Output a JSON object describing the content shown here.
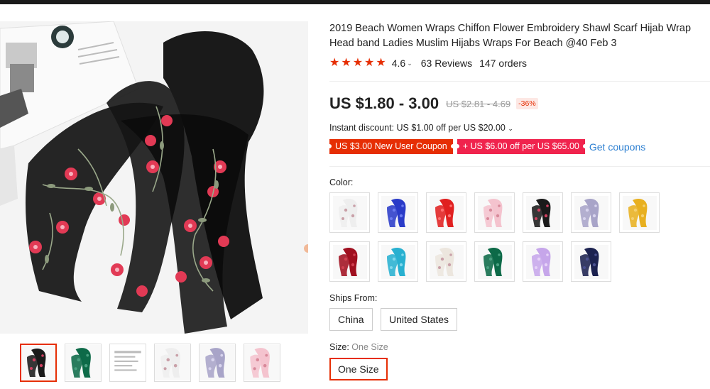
{
  "product": {
    "title": "2019 Beach Women Wraps Chiffon Flower Embroidery Shawl Scarf Hijab Wrap Head band Ladies Muslim Hijabs Wraps For Beach @40 Feb 3",
    "rating": "4.6",
    "reviews": "63 Reviews",
    "orders": "147 orders",
    "price": "US $1.80 - 3.00",
    "original_price": "US $2.81 - 4.69",
    "discount": "-36%",
    "instant_discount": "Instant discount: US $1.00 off per US $20.00",
    "coupons": [
      "US $3.00 New User Coupon",
      "+ US $6.00 off per US $65.00"
    ],
    "get_coupons": "Get coupons"
  },
  "colors": {
    "brand": "#e62e04",
    "link": "#2c7fd1"
  },
  "options": {
    "color_label": "Color:",
    "color_swatches": [
      {
        "name": "white",
        "color": "#eeeeee",
        "accent": "#c9a0a8"
      },
      {
        "name": "royal-blue",
        "color": "#2a3bc8",
        "accent": "#6b7bf0"
      },
      {
        "name": "red",
        "color": "#e02020",
        "accent": "#ff7070"
      },
      {
        "name": "light-pink",
        "color": "#f4c3ce",
        "accent": "#d8899a"
      },
      {
        "name": "black",
        "color": "#1a1a1a",
        "accent": "#d04060"
      },
      {
        "name": "lavender-grey",
        "color": "#a8a4c8",
        "accent": "#d8d4ee"
      },
      {
        "name": "mustard",
        "color": "#e8b020",
        "accent": "#f5d070"
      },
      {
        "name": "burgundy",
        "color": "#a01020",
        "accent": "#d04050"
      },
      {
        "name": "turquoise",
        "color": "#28b0d0",
        "accent": "#80d8ec"
      },
      {
        "name": "ivory",
        "color": "#ece6de",
        "accent": "#c9a0a8"
      },
      {
        "name": "dark-green",
        "color": "#0d6a48",
        "accent": "#4aa080"
      },
      {
        "name": "lilac",
        "color": "#c6a6ea",
        "accent": "#e6d2f8"
      },
      {
        "name": "navy",
        "color": "#1c2250",
        "accent": "#4a5090"
      }
    ],
    "ships_from_label": "Ships From:",
    "ships_from": [
      "China",
      "United States"
    ],
    "size_label": "Size:",
    "size_selected": "One Size",
    "sizes": [
      "One Size"
    ]
  },
  "gallery": {
    "thumbnails": [
      {
        "name": "black",
        "color": "#1a1a1a",
        "accent": "#d04060"
      },
      {
        "name": "dark-green",
        "color": "#0d6a48",
        "accent": "#4aa080"
      },
      {
        "name": "size-chart",
        "color": "#ffffff",
        "accent": "#bbbbbb"
      },
      {
        "name": "white",
        "color": "#eeeeee",
        "accent": "#c9a0a8"
      },
      {
        "name": "lavender-grey",
        "color": "#a8a4c8",
        "accent": "#d8d4ee"
      },
      {
        "name": "light-pink",
        "color": "#f4c3ce",
        "accent": "#d8899a"
      }
    ]
  }
}
